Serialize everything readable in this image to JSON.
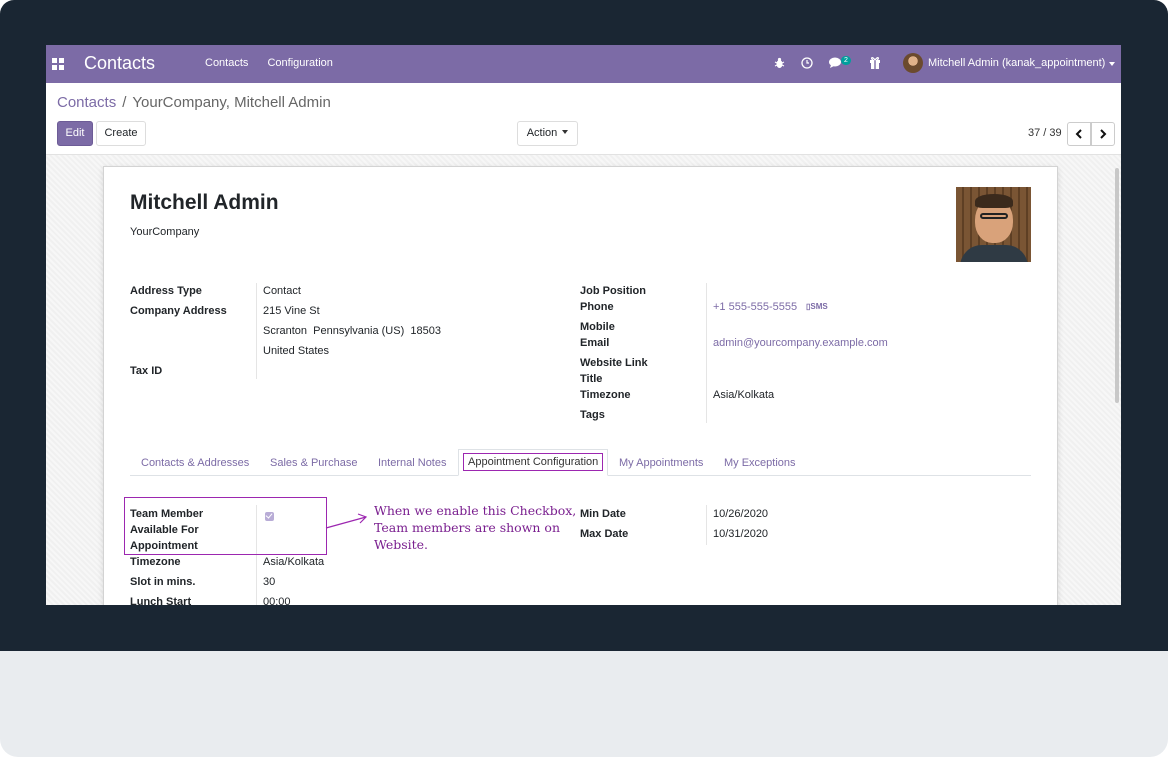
{
  "navbar": {
    "brand": "Contacts",
    "menu": [
      "Contacts",
      "Configuration"
    ],
    "icons": [
      "apps-icon",
      "bug-icon",
      "clock-icon",
      "chat-icon",
      "gift-icon"
    ],
    "chat_badge": "2",
    "user": "Mitchell Admin (kanak_appointment)",
    "color": "#7c6ba6"
  },
  "breadcrumb": {
    "parent": "Contacts",
    "separator": "/",
    "current": "YourCompany, Mitchell Admin"
  },
  "toolbar": {
    "edit_label": "Edit",
    "create_label": "Create",
    "action_label": "Action",
    "pager": "37 / 39",
    "prev_icon": "chevron-left-icon",
    "next_icon": "chevron-right-icon"
  },
  "record": {
    "name": "Mitchell Admin",
    "company": "YourCompany"
  },
  "left_fields": {
    "address_type_label": "Address Type",
    "address_type_value": "Contact",
    "company_address_label": "Company Address",
    "address_line1": "215 Vine St",
    "address_line2": "Scranton  Pennsylvania (US)  18503",
    "address_line3": "United States",
    "tax_id_label": "Tax ID"
  },
  "right_fields": {
    "job_position_label": "Job Position",
    "phone_label": "Phone",
    "phone_value": "+1 555-555-5555",
    "sms_label": "SMS",
    "mobile_label": "Mobile",
    "email_label": "Email",
    "email_value": "admin@yourcompany.example.com",
    "website_label": "Website Link",
    "title_label": "Title",
    "timezone_label": "Timezone",
    "timezone_value": "Asia/Kolkata",
    "tags_label": "Tags"
  },
  "tabs": [
    "Contacts & Addresses",
    "Sales & Purchase",
    "Internal Notes",
    "Appointment Configuration",
    "My Appointments",
    "My Exceptions"
  ],
  "appointment": {
    "team_member_label_1": "Team Member",
    "team_member_label_2": "Available For",
    "team_member_label_3": "Appointment",
    "team_member_checked": true,
    "timezone_label": "Timezone",
    "timezone_value": "Asia/Kolkata",
    "slot_label": "Slot in mins.",
    "slot_value": "30",
    "lunch_start_label": "Lunch Start",
    "lunch_start_value": "00:00",
    "min_date_label": "Min Date",
    "min_date_value": "10/26/2020",
    "max_date_label": "Max Date",
    "max_date_value": "10/31/2020"
  },
  "annotation": {
    "line1": "When we enable this Checkbox,",
    "line2": "Team members are shown on",
    "line3": "Website.",
    "color": "#9c27b0"
  }
}
